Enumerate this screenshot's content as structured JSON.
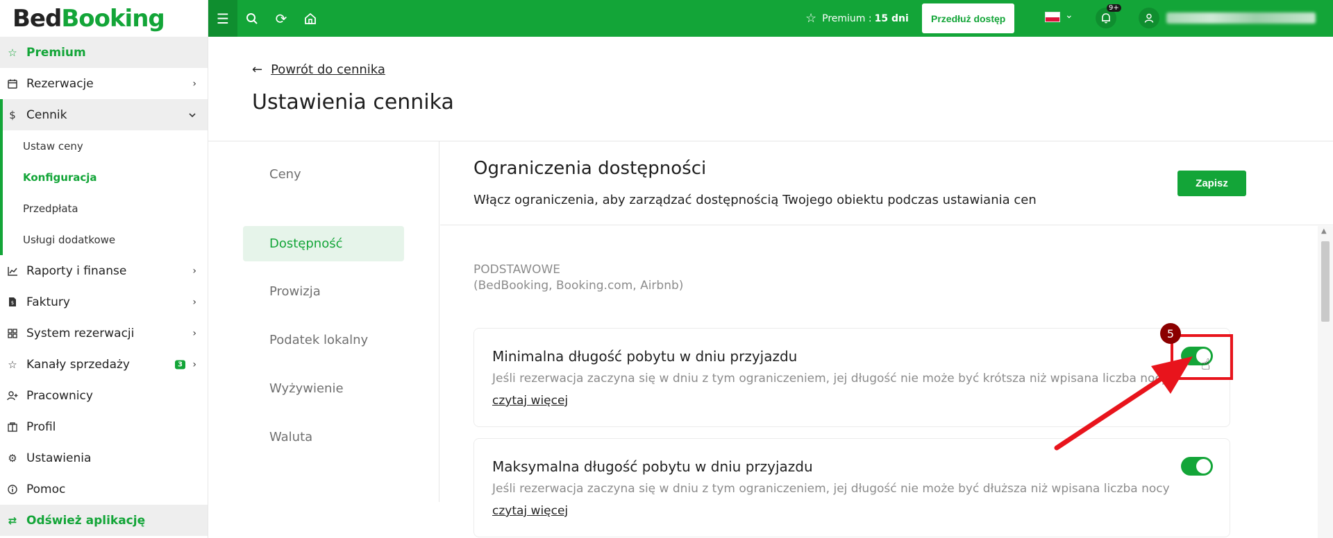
{
  "app": {
    "logo_part1": "Bed",
    "logo_part2": "Booking",
    "accent_color": "#13a538"
  },
  "sidebar": {
    "premium": {
      "label": "Premium",
      "icon": "star-icon"
    },
    "items": [
      {
        "label": "Rezerwacje",
        "icon": "calendar-icon",
        "chevron": "›"
      },
      {
        "label": "Cennik",
        "icon": "dollar-icon",
        "chevron": "⌄"
      },
      {
        "label": "Raporty i finanse",
        "icon": "chart-icon",
        "chevron": "›"
      },
      {
        "label": "Faktury",
        "icon": "invoice-icon",
        "chevron": "›"
      },
      {
        "label": "System rezerwacji",
        "icon": "grid-icon",
        "chevron": "›"
      },
      {
        "label": "Kanały sprzedaży",
        "icon": "star-icon",
        "chevron": "›",
        "badge": "3"
      },
      {
        "label": "Pracownicy",
        "icon": "user-add-icon"
      },
      {
        "label": "Profil",
        "icon": "building-icon"
      },
      {
        "label": "Ustawienia",
        "icon": "gear-icon"
      },
      {
        "label": "Pomoc",
        "icon": "info-icon"
      }
    ],
    "cennik_submenu": [
      {
        "label": "Ustaw ceny"
      },
      {
        "label": "Konfiguracja",
        "active": true
      },
      {
        "label": "Przedpłata"
      },
      {
        "label": "Usługi dodatkowe"
      }
    ],
    "refresh": {
      "label": "Odśwież aplikację",
      "icon": "refresh-icon"
    }
  },
  "topbar": {
    "premium_label": "Premium :",
    "premium_days": "15 dni",
    "extend_button": "Przedłuż dostęp",
    "notification_count": "9+",
    "language": "PL"
  },
  "page": {
    "back_link": "Powrót do cennika",
    "title": "Ustawienia cennika"
  },
  "tabs": [
    {
      "label": "Ceny"
    },
    {
      "label": "Dostępność",
      "active": true
    },
    {
      "label": "Prowizja"
    },
    {
      "label": "Podatek lokalny"
    },
    {
      "label": "Wyżywienie"
    },
    {
      "label": "Waluta"
    }
  ],
  "section": {
    "title": "Ograniczenia dostępności",
    "description": "Włącz ograniczenia, aby zarządzać dostępnością Twojego obiektu podczas ustawiania cen",
    "save_button": "Zapisz",
    "group_label_line1": "PODSTAWOWE",
    "group_label_line2": "(BedBooking, Booking.com, Airbnb)"
  },
  "cards": [
    {
      "title": "Minimalna długość pobytu w dniu przyjazdu",
      "description": "Jeśli rezerwacja zaczyna się w dniu z tym ograniczeniem, jej długość nie może być krótsza niż wpisana liczba nocy",
      "link": "czytaj więcej",
      "enabled": true
    },
    {
      "title": "Maksymalna długość pobytu w dniu przyjazdu",
      "description": "Jeśli rezerwacja zaczyna się w dniu z tym ograniczeniem, jej długość nie może być dłuższa niż wpisana liczba nocy",
      "link": "czytaj więcej",
      "enabled": true
    }
  ],
  "annotation": {
    "step_number": "5",
    "color": "#e8141c"
  }
}
